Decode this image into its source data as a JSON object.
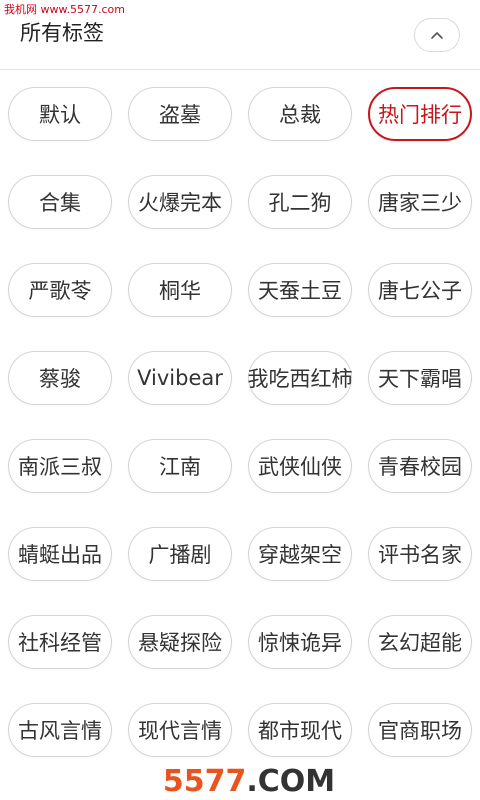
{
  "watermark_top": "我机网 www.5577.com",
  "header": {
    "title": "所有标签",
    "collapse_icon": "chevron-up-icon"
  },
  "active_color": "#c8161d",
  "tags": [
    {
      "label": "默认",
      "active": false
    },
    {
      "label": "盗墓",
      "active": false
    },
    {
      "label": "总裁",
      "active": false
    },
    {
      "label": "热门排行",
      "active": true
    },
    {
      "label": "合集",
      "active": false
    },
    {
      "label": "火爆完本",
      "active": false
    },
    {
      "label": "孔二狗",
      "active": false
    },
    {
      "label": "唐家三少",
      "active": false
    },
    {
      "label": "严歌苓",
      "active": false
    },
    {
      "label": "桐华",
      "active": false
    },
    {
      "label": "天蚕土豆",
      "active": false
    },
    {
      "label": "唐七公子",
      "active": false
    },
    {
      "label": "蔡骏",
      "active": false
    },
    {
      "label": "Vivibear",
      "active": false
    },
    {
      "label": "我吃西红柿",
      "active": false
    },
    {
      "label": "天下霸唱",
      "active": false
    },
    {
      "label": "南派三叔",
      "active": false
    },
    {
      "label": "江南",
      "active": false
    },
    {
      "label": "武侠仙侠",
      "active": false
    },
    {
      "label": "青春校园",
      "active": false
    },
    {
      "label": "蜻蜓出品",
      "active": false
    },
    {
      "label": "广播剧",
      "active": false
    },
    {
      "label": "穿越架空",
      "active": false
    },
    {
      "label": "评书名家",
      "active": false
    },
    {
      "label": "社科经管",
      "active": false
    },
    {
      "label": "悬疑探险",
      "active": false
    },
    {
      "label": "惊悚诡异",
      "active": false
    },
    {
      "label": "玄幻超能",
      "active": false
    },
    {
      "label": "古风言情",
      "active": false
    },
    {
      "label": "现代言情",
      "active": false
    },
    {
      "label": "都市现代",
      "active": false
    },
    {
      "label": "官商职场",
      "active": false
    }
  ],
  "footer_watermark": {
    "number": "5577",
    "suffix": ".COM"
  }
}
